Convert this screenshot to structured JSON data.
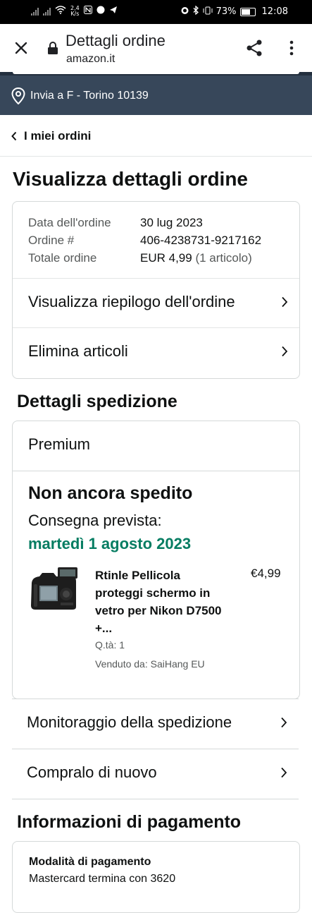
{
  "status_bar": {
    "speed_value": "2,4",
    "speed_unit": "K/s",
    "battery": "73%",
    "time": "12:08"
  },
  "browser": {
    "title": "Dettagli ordine",
    "domain": "amazon.it"
  },
  "delivery_bar": {
    "text": "Invia a F - Torino 10139"
  },
  "nav": {
    "back_label": "I miei ordini"
  },
  "page": {
    "title": "Visualizza dettagli ordine"
  },
  "order_summary": {
    "rows": [
      {
        "label": "Data dell'ordine",
        "value": "30 lug 2023"
      },
      {
        "label": "Ordine #",
        "value": "406-4238731-9217162"
      },
      {
        "label": "Totale ordine",
        "value": "EUR 4,99",
        "extra": "(1 articolo)"
      }
    ],
    "links": [
      {
        "label": "Visualizza riepilogo dell'ordine"
      },
      {
        "label": "Elimina articoli"
      }
    ]
  },
  "shipping": {
    "heading": "Dettagli spedizione",
    "service": "Premium",
    "status": "Non ancora spedito",
    "expected_label": "Consegna prevista:",
    "expected_date": "martedì 1 agosto 2023",
    "item": {
      "title": "Rtinle Pellicola proteggi schermo in vetro per Nikon D7500 +...",
      "price": "€4,99",
      "qty": "Q.tà: 1",
      "seller": "Venduto da: SaiHang EU"
    },
    "actions": [
      {
        "label": "Monitoraggio della spedizione"
      },
      {
        "label": "Compralo di nuovo"
      }
    ]
  },
  "payment": {
    "heading": "Informazioni di pagamento",
    "method_label": "Modalità di pagamento",
    "method_value": "Mastercard  termina con 3620"
  },
  "colors": {
    "deliver_bar_bg": "#37475a",
    "header_dark": "#232f3e",
    "delivery_date_green": "#067d62",
    "border": "#d5d9d9"
  },
  "icons": [
    "close-icon",
    "lock-icon",
    "share-icon",
    "more-vert-icon",
    "location-pin-icon",
    "chevron-left-icon",
    "chevron-right-icon"
  ]
}
